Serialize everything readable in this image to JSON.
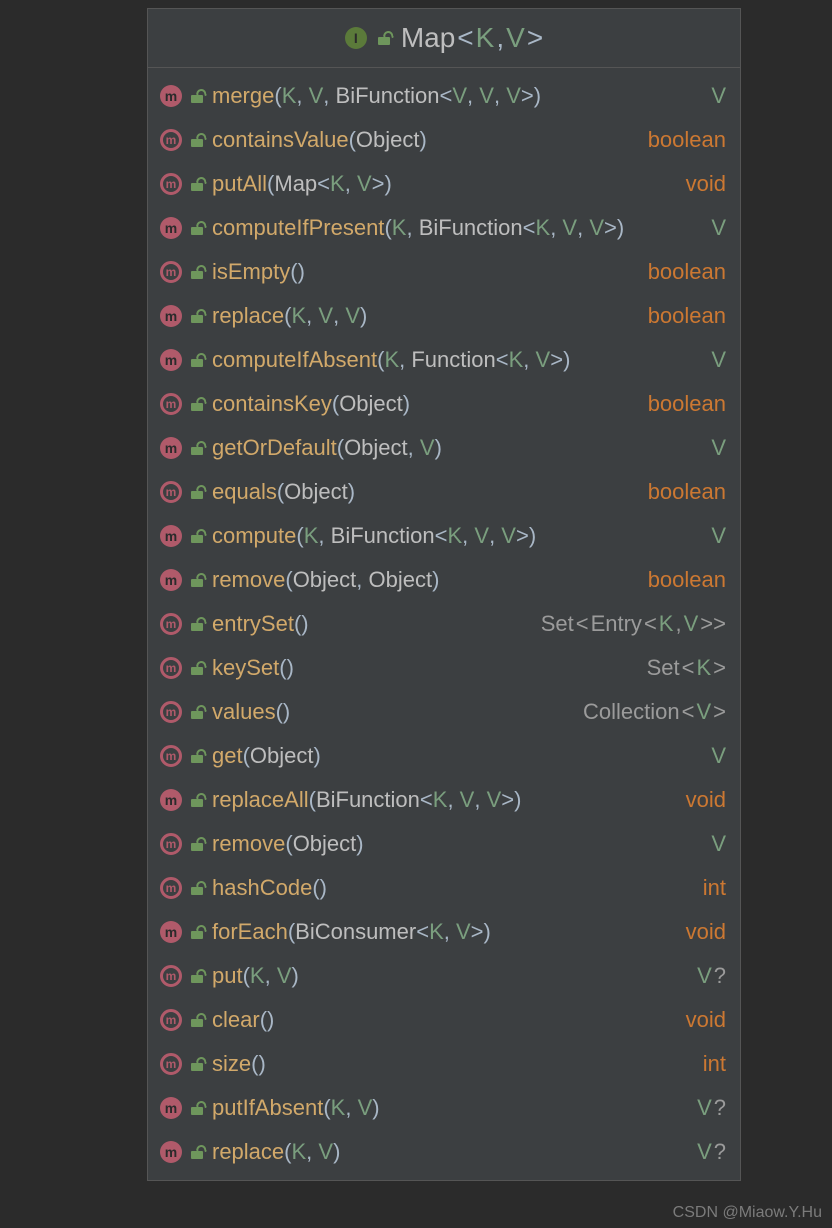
{
  "header": {
    "icon_letter": "I",
    "title_parts": [
      {
        "t": "Map",
        "c": "plain"
      },
      {
        "t": "<",
        "c": "angle"
      },
      {
        "t": "K",
        "c": "type"
      },
      {
        "t": ", ",
        "c": "punc"
      },
      {
        "t": "V",
        "c": "type"
      },
      {
        "t": ">",
        "c": "angle"
      }
    ]
  },
  "methods": [
    {
      "abs": false,
      "name": "merge",
      "params": [
        {
          "t": "(",
          "c": "punc"
        },
        {
          "t": "K",
          "c": "type"
        },
        {
          "t": ", ",
          "c": "punc"
        },
        {
          "t": "V",
          "c": "type"
        },
        {
          "t": ", ",
          "c": "punc"
        },
        {
          "t": "BiFunction",
          "c": "plain"
        },
        {
          "t": "<",
          "c": "angle"
        },
        {
          "t": "V",
          "c": "type"
        },
        {
          "t": ", ",
          "c": "punc"
        },
        {
          "t": "V",
          "c": "type"
        },
        {
          "t": ", ",
          "c": "punc"
        },
        {
          "t": "V",
          "c": "type"
        },
        {
          "t": ">",
          "c": "angle"
        },
        {
          "t": ")",
          "c": "punc"
        }
      ],
      "ret": [
        {
          "t": "V",
          "c": "ret-type"
        }
      ]
    },
    {
      "abs": true,
      "name": "containsValue",
      "params": [
        {
          "t": "(",
          "c": "punc"
        },
        {
          "t": "Object",
          "c": "plain"
        },
        {
          "t": ")",
          "c": "punc"
        }
      ],
      "ret": [
        {
          "t": "boolean",
          "c": "ret-kw"
        }
      ]
    },
    {
      "abs": true,
      "name": "putAll",
      "params": [
        {
          "t": "(",
          "c": "punc"
        },
        {
          "t": "Map",
          "c": "plain"
        },
        {
          "t": "<",
          "c": "angle"
        },
        {
          "t": "K",
          "c": "type"
        },
        {
          "t": ", ",
          "c": "punc"
        },
        {
          "t": "V",
          "c": "type"
        },
        {
          "t": ">",
          "c": "angle"
        },
        {
          "t": ")",
          "c": "punc"
        }
      ],
      "ret": [
        {
          "t": "void",
          "c": "ret-kw"
        }
      ]
    },
    {
      "abs": false,
      "name": "computeIfPresent",
      "params": [
        {
          "t": "(",
          "c": "punc"
        },
        {
          "t": "K",
          "c": "type"
        },
        {
          "t": ", ",
          "c": "punc"
        },
        {
          "t": "BiFunction",
          "c": "plain"
        },
        {
          "t": "<",
          "c": "angle"
        },
        {
          "t": "K",
          "c": "type"
        },
        {
          "t": ", ",
          "c": "punc"
        },
        {
          "t": "V",
          "c": "type"
        },
        {
          "t": ", ",
          "c": "punc"
        },
        {
          "t": "V",
          "c": "type"
        },
        {
          "t": ">",
          "c": "angle"
        },
        {
          "t": ")",
          "c": "punc"
        }
      ],
      "ret": [
        {
          "t": "V",
          "c": "ret-type"
        }
      ]
    },
    {
      "abs": true,
      "name": "isEmpty",
      "params": [
        {
          "t": "(",
          "c": "punc"
        },
        {
          "t": ")",
          "c": "punc"
        }
      ],
      "ret": [
        {
          "t": "boolean",
          "c": "ret-kw"
        }
      ]
    },
    {
      "abs": false,
      "name": "replace",
      "params": [
        {
          "t": "(",
          "c": "punc"
        },
        {
          "t": "K",
          "c": "type"
        },
        {
          "t": ", ",
          "c": "punc"
        },
        {
          "t": "V",
          "c": "type"
        },
        {
          "t": ", ",
          "c": "punc"
        },
        {
          "t": "V",
          "c": "type"
        },
        {
          "t": ")",
          "c": "punc"
        }
      ],
      "ret": [
        {
          "t": "boolean",
          "c": "ret-kw"
        }
      ]
    },
    {
      "abs": false,
      "name": "computeIfAbsent",
      "params": [
        {
          "t": "(",
          "c": "punc"
        },
        {
          "t": "K",
          "c": "type"
        },
        {
          "t": ", ",
          "c": "punc"
        },
        {
          "t": "Function",
          "c": "plain"
        },
        {
          "t": "<",
          "c": "angle"
        },
        {
          "t": "K",
          "c": "type"
        },
        {
          "t": ", ",
          "c": "punc"
        },
        {
          "t": "V",
          "c": "type"
        },
        {
          "t": ">",
          "c": "angle"
        },
        {
          "t": ")",
          "c": "punc"
        }
      ],
      "ret": [
        {
          "t": "V",
          "c": "ret-type"
        }
      ]
    },
    {
      "abs": true,
      "name": "containsKey",
      "params": [
        {
          "t": "(",
          "c": "punc"
        },
        {
          "t": "Object",
          "c": "plain"
        },
        {
          "t": ")",
          "c": "punc"
        }
      ],
      "ret": [
        {
          "t": "boolean",
          "c": "ret-kw"
        }
      ]
    },
    {
      "abs": false,
      "name": "getOrDefault",
      "params": [
        {
          "t": "(",
          "c": "punc"
        },
        {
          "t": "Object",
          "c": "plain"
        },
        {
          "t": ", ",
          "c": "punc"
        },
        {
          "t": "V",
          "c": "type"
        },
        {
          "t": ")",
          "c": "punc"
        }
      ],
      "ret": [
        {
          "t": "V",
          "c": "ret-type"
        }
      ]
    },
    {
      "abs": true,
      "name": "equals",
      "params": [
        {
          "t": "(",
          "c": "punc"
        },
        {
          "t": "Object",
          "c": "plain"
        },
        {
          "t": ")",
          "c": "punc"
        }
      ],
      "ret": [
        {
          "t": "boolean",
          "c": "ret-kw"
        }
      ]
    },
    {
      "abs": false,
      "name": "compute",
      "params": [
        {
          "t": "(",
          "c": "punc"
        },
        {
          "t": "K",
          "c": "type"
        },
        {
          "t": ", ",
          "c": "punc"
        },
        {
          "t": "BiFunction",
          "c": "plain"
        },
        {
          "t": "<",
          "c": "angle"
        },
        {
          "t": "K",
          "c": "type"
        },
        {
          "t": ", ",
          "c": "punc"
        },
        {
          "t": "V",
          "c": "type"
        },
        {
          "t": ", ",
          "c": "punc"
        },
        {
          "t": "V",
          "c": "type"
        },
        {
          "t": ">",
          "c": "angle"
        },
        {
          "t": ")",
          "c": "punc"
        }
      ],
      "ret": [
        {
          "t": "V",
          "c": "ret-type"
        }
      ]
    },
    {
      "abs": false,
      "name": "remove",
      "params": [
        {
          "t": "(",
          "c": "punc"
        },
        {
          "t": "Object",
          "c": "plain"
        },
        {
          "t": ", ",
          "c": "punc"
        },
        {
          "t": "Object",
          "c": "plain"
        },
        {
          "t": ")",
          "c": "punc"
        }
      ],
      "ret": [
        {
          "t": "boolean",
          "c": "ret-kw"
        }
      ]
    },
    {
      "abs": true,
      "name": "entrySet",
      "params": [
        {
          "t": "(",
          "c": "punc"
        },
        {
          "t": ")",
          "c": "punc"
        }
      ],
      "ret": [
        {
          "t": "Set",
          "c": "ret-plain"
        },
        {
          "t": "<",
          "c": "ret-plain"
        },
        {
          "t": "Entry",
          "c": "ret-plain"
        },
        {
          "t": "<",
          "c": "ret-plain"
        },
        {
          "t": "K",
          "c": "ret-type"
        },
        {
          "t": ", ",
          "c": "ret-plain"
        },
        {
          "t": "V",
          "c": "ret-type"
        },
        {
          "t": ">>",
          "c": "ret-plain"
        }
      ]
    },
    {
      "abs": true,
      "name": "keySet",
      "params": [
        {
          "t": "(",
          "c": "punc"
        },
        {
          "t": ")",
          "c": "punc"
        }
      ],
      "ret": [
        {
          "t": "Set",
          "c": "ret-plain"
        },
        {
          "t": "<",
          "c": "ret-plain"
        },
        {
          "t": "K",
          "c": "ret-type"
        },
        {
          "t": ">",
          "c": "ret-plain"
        }
      ]
    },
    {
      "abs": true,
      "name": "values",
      "params": [
        {
          "t": "(",
          "c": "punc"
        },
        {
          "t": ")",
          "c": "punc"
        }
      ],
      "ret": [
        {
          "t": "Collection",
          "c": "ret-plain"
        },
        {
          "t": "<",
          "c": "ret-plain"
        },
        {
          "t": "V",
          "c": "ret-type"
        },
        {
          "t": ">",
          "c": "ret-plain"
        }
      ]
    },
    {
      "abs": true,
      "name": "get",
      "params": [
        {
          "t": "(",
          "c": "punc"
        },
        {
          "t": "Object",
          "c": "plain"
        },
        {
          "t": ")",
          "c": "punc"
        }
      ],
      "ret": [
        {
          "t": "V",
          "c": "ret-type"
        }
      ]
    },
    {
      "abs": false,
      "name": "replaceAll",
      "params": [
        {
          "t": "(",
          "c": "punc"
        },
        {
          "t": "BiFunction",
          "c": "plain"
        },
        {
          "t": "<",
          "c": "angle"
        },
        {
          "t": "K",
          "c": "type"
        },
        {
          "t": ", ",
          "c": "punc"
        },
        {
          "t": "V",
          "c": "type"
        },
        {
          "t": ", ",
          "c": "punc"
        },
        {
          "t": "V",
          "c": "type"
        },
        {
          "t": ">",
          "c": "angle"
        },
        {
          "t": ")",
          "c": "punc"
        }
      ],
      "ret": [
        {
          "t": "void",
          "c": "ret-kw"
        }
      ]
    },
    {
      "abs": true,
      "name": "remove",
      "params": [
        {
          "t": "(",
          "c": "punc"
        },
        {
          "t": "Object",
          "c": "plain"
        },
        {
          "t": ")",
          "c": "punc"
        }
      ],
      "ret": [
        {
          "t": "V",
          "c": "ret-type"
        }
      ]
    },
    {
      "abs": true,
      "name": "hashCode",
      "params": [
        {
          "t": "(",
          "c": "punc"
        },
        {
          "t": ")",
          "c": "punc"
        }
      ],
      "ret": [
        {
          "t": "int",
          "c": "ret-kw"
        }
      ]
    },
    {
      "abs": false,
      "name": "forEach",
      "params": [
        {
          "t": "(",
          "c": "punc"
        },
        {
          "t": "BiConsumer",
          "c": "plain"
        },
        {
          "t": "<",
          "c": "angle"
        },
        {
          "t": "K",
          "c": "type"
        },
        {
          "t": ", ",
          "c": "punc"
        },
        {
          "t": "V",
          "c": "type"
        },
        {
          "t": ">",
          "c": "angle"
        },
        {
          "t": ")",
          "c": "punc"
        }
      ],
      "ret": [
        {
          "t": "void",
          "c": "ret-kw"
        }
      ]
    },
    {
      "abs": true,
      "name": "put",
      "params": [
        {
          "t": "(",
          "c": "punc"
        },
        {
          "t": "K",
          "c": "type"
        },
        {
          "t": ", ",
          "c": "punc"
        },
        {
          "t": "V",
          "c": "type"
        },
        {
          "t": ")",
          "c": "punc"
        }
      ],
      "ret": [
        {
          "t": "V",
          "c": "ret-type"
        },
        {
          "t": "?",
          "c": "ret-plain"
        }
      ]
    },
    {
      "abs": true,
      "name": "clear",
      "params": [
        {
          "t": "(",
          "c": "punc"
        },
        {
          "t": ")",
          "c": "punc"
        }
      ],
      "ret": [
        {
          "t": "void",
          "c": "ret-kw"
        }
      ]
    },
    {
      "abs": true,
      "name": "size",
      "params": [
        {
          "t": "(",
          "c": "punc"
        },
        {
          "t": ")",
          "c": "punc"
        }
      ],
      "ret": [
        {
          "t": "int",
          "c": "ret-kw"
        }
      ]
    },
    {
      "abs": false,
      "name": "putIfAbsent",
      "params": [
        {
          "t": "(",
          "c": "punc"
        },
        {
          "t": "K",
          "c": "type"
        },
        {
          "t": ", ",
          "c": "punc"
        },
        {
          "t": "V",
          "c": "type"
        },
        {
          "t": ")",
          "c": "punc"
        }
      ],
      "ret": [
        {
          "t": "V",
          "c": "ret-type"
        },
        {
          "t": "?",
          "c": "ret-plain"
        }
      ]
    },
    {
      "abs": false,
      "name": "replace",
      "params": [
        {
          "t": "(",
          "c": "punc"
        },
        {
          "t": "K",
          "c": "type"
        },
        {
          "t": ", ",
          "c": "punc"
        },
        {
          "t": "V",
          "c": "type"
        },
        {
          "t": ")",
          "c": "punc"
        }
      ],
      "ret": [
        {
          "t": "V",
          "c": "ret-type"
        },
        {
          "t": "?",
          "c": "ret-plain"
        }
      ]
    }
  ],
  "watermark": "CSDN @Miaow.Y.Hu"
}
